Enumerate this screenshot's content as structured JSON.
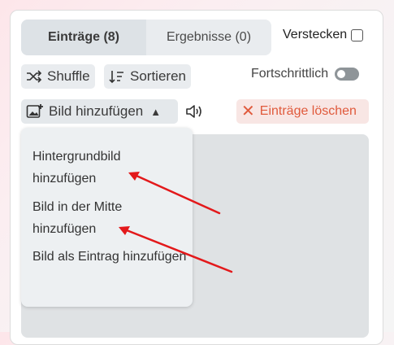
{
  "tabs": {
    "entries_label": "Einträge (8)",
    "results_label": "Ergebnisse (0)"
  },
  "hide_label": "Verstecken",
  "toolbar": {
    "shuffle_label": "Shuffle",
    "sort_label": "Sortieren",
    "advanced_label": "Fortschrittlich",
    "add_image_label": "Bild hinzufügen",
    "add_image_caret": "▲",
    "delete_label": "Einträge löschen",
    "delete_icon": "✕"
  },
  "menu": {
    "items": [
      {
        "label": "Hintergrundbild hinzufügen"
      },
      {
        "label": "Bild in der Mitte hinzufügen"
      },
      {
        "label": "Bild als Eintrag hinzufügen"
      }
    ]
  },
  "colors": {
    "arrow": "#e3191b",
    "delete_text": "#e05a3c",
    "delete_bg": "#f8e6e4"
  }
}
